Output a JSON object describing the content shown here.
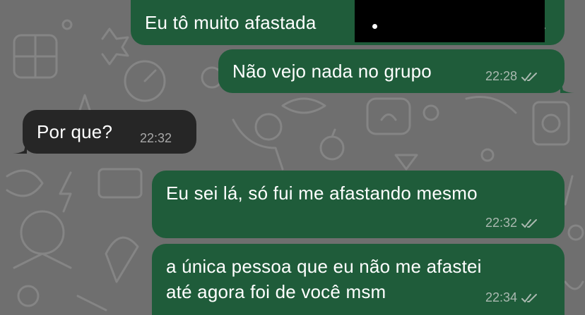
{
  "chat": {
    "messages": [
      {
        "direction": "outgoing",
        "text": "Eu tô muito afastada",
        "time": "",
        "status": "read"
      },
      {
        "direction": "outgoing",
        "text": "Não vejo nada no grupo",
        "time": "22:28",
        "status": "read"
      },
      {
        "direction": "incoming",
        "text": "Por que?",
        "time": "22:32"
      },
      {
        "direction": "outgoing",
        "text": "Eu sei lá, só fui me afastando mesmo",
        "time": "22:32",
        "status": "read"
      },
      {
        "direction": "outgoing",
        "lines": [
          "a única pessoa que eu não me afastei",
          "até agora foi de você msm"
        ],
        "time": "22:34",
        "status": "read"
      }
    ]
  },
  "colors": {
    "wallpaper": "#6f6f6f",
    "outgoing_bubble": "#1f5c3a",
    "incoming_bubble": "#262626",
    "redaction": "#000000",
    "meta_text": "#aab9b0"
  },
  "icons": {
    "read_receipt": "double-check-icon",
    "wallpaper": "doodle-pattern"
  }
}
